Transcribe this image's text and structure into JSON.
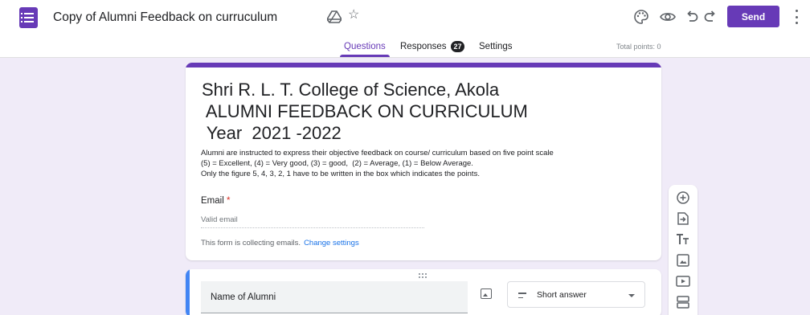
{
  "app": {
    "icon": "google-forms-icon",
    "title": "Copy of Alumni Feedback on curruculum"
  },
  "header_icons": [
    "palette-icon",
    "eye-preview-icon",
    "undo-icon",
    "redo-icon"
  ],
  "send_label": "Send",
  "tabs": [
    {
      "label": "Questions",
      "active": true
    },
    {
      "label": "Responses",
      "badge": "27"
    },
    {
      "label": "Settings"
    }
  ],
  "total_points": "Total points: 0",
  "form": {
    "title_lines": [
      "Shri R. L. T. College of Science, Akola",
      " ALUMNI FEEDBACK ON CURRICULUM",
      " Year  2021 -2022"
    ],
    "description_lines": [
      "Alumni are instructed to express their objective feedback on course/ curriculum based on five point scale",
      "(5) = Excellent, (4) = Very good, (3) = good,  (2) = Average, (1) = Below Average.",
      "Only the figure 5, 4, 3, 2, 1 have to be written in the box which indicates the points."
    ],
    "email_label": "Email",
    "required_mark": "*",
    "email_placeholder": "Valid email",
    "collect_note": "This form is collecting emails.",
    "change_settings": "Change settings"
  },
  "question": {
    "title": "Name of Alumni",
    "type": "Short answer"
  },
  "colors": {
    "accent": "#673ab7",
    "background": "#f0ebf8",
    "active_question_bar": "#4285f4",
    "link": "#1a73e8"
  },
  "side_toolbar": [
    "add-question-icon",
    "import-questions-icon",
    "add-title-icon",
    "add-image-icon",
    "add-video-icon",
    "add-section-icon"
  ]
}
